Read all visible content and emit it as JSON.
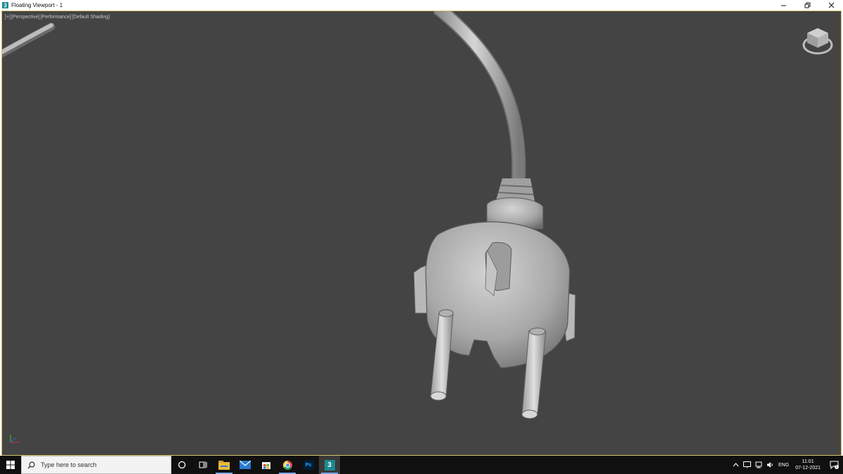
{
  "window": {
    "title": "Floating Viewport - 1",
    "icon": "3dsmax-icon"
  },
  "viewport": {
    "labels": [
      "[+]",
      "[Perspective]",
      "[Performance]",
      "[Default Shading]"
    ],
    "background_color": "#444444",
    "border_color": "#d4c26c",
    "scene_object": "power-plug-with-cable"
  },
  "taskbar": {
    "search_placeholder": "Type here to search",
    "apps": [
      {
        "name": "task-view-icon"
      },
      {
        "name": "file-explorer-icon"
      },
      {
        "name": "mail-icon"
      },
      {
        "name": "store-icon"
      },
      {
        "name": "chrome-icon"
      },
      {
        "name": "photoshop-icon",
        "label": "Ps"
      },
      {
        "name": "3dsmax-icon",
        "label": "3",
        "active": true
      }
    ],
    "tray": {
      "language": "ENG",
      "time": "11:01",
      "date": "07-12-2021",
      "notification_count": "1"
    }
  }
}
